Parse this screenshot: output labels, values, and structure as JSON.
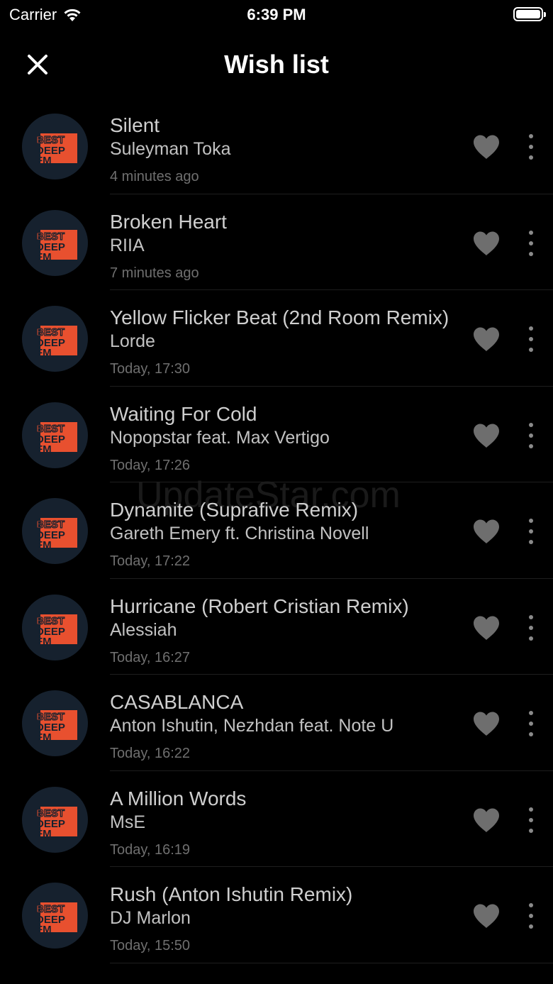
{
  "status_bar": {
    "carrier": "Carrier",
    "time": "6:39 PM"
  },
  "nav": {
    "title": "Wish list",
    "close_icon": "close-icon"
  },
  "colors": {
    "background": "#000000",
    "logo_bg": "#16212e",
    "logo_accent": "#e8502f",
    "heart": "#6e6e6e"
  },
  "watermark": "UpdateStar.com",
  "tracks": [
    {
      "title": "Silent",
      "artist": "Suleyman Toka",
      "time": "4 minutes ago"
    },
    {
      "title": "Broken Heart",
      "artist": "RIIA",
      "time": "7 minutes ago"
    },
    {
      "title": "Yellow Flicker Beat (2nd Room Remix)",
      "artist": "Lorde",
      "time": "Today, 17:30"
    },
    {
      "title": "Waiting For Cold",
      "artist": "Nopopstar feat. Max Vertigo",
      "time": "Today, 17:26"
    },
    {
      "title": "Dynamite (Suprafive Remix)",
      "artist": "Gareth Emery ft. Christina Novell",
      "time": "Today, 17:22"
    },
    {
      "title": "Hurricane (Robert Cristian Remix)",
      "artist": "Alessiah",
      "time": "Today, 16:27"
    },
    {
      "title": "CASABLANCA",
      "artist": "Anton Ishutin, Nezhdan feat. Note U",
      "time": "Today, 16:22"
    },
    {
      "title": "A Million Words",
      "artist": "MsE",
      "time": "Today, 16:19"
    },
    {
      "title": "Rush (Anton Ishutin Remix)",
      "artist": "DJ Marlon",
      "time": "Today, 15:50"
    }
  ]
}
